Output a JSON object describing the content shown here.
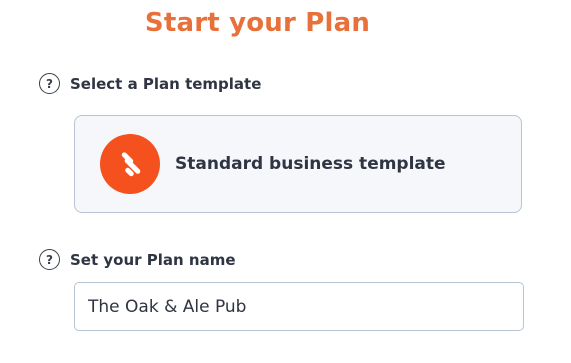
{
  "title": "Start your Plan",
  "template_section": {
    "help_icon_glyph": "?",
    "label": "Select a Plan template",
    "selected_template": {
      "name": "Standard business template",
      "icon": "business-template-logo-icon",
      "icon_color": "#f4511e"
    }
  },
  "name_section": {
    "help_icon_glyph": "?",
    "label": "Set your Plan name",
    "input_value": "The Oak & Ale Pub"
  },
  "colors": {
    "title": "#e8703a",
    "card_background": "#f5f7fa",
    "border": "#b9c4d3"
  }
}
